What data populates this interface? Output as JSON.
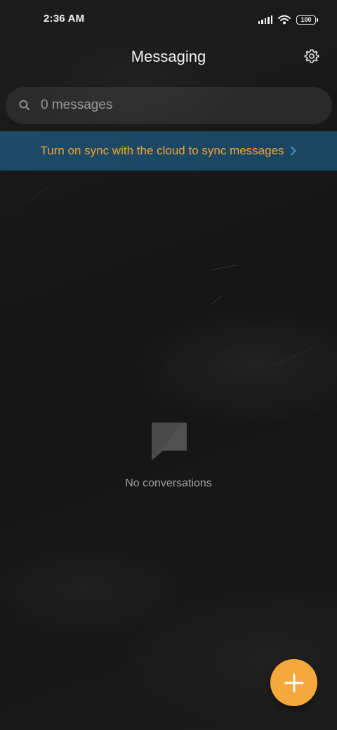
{
  "status_bar": {
    "time": "2:36 AM",
    "battery": "100",
    "icons": [
      "signal-icon",
      "wifi-icon",
      "battery-icon"
    ]
  },
  "header": {
    "title": "Messaging",
    "settings_icon": "gear-icon"
  },
  "search": {
    "placeholder": "0 messages",
    "icon": "search-icon"
  },
  "sync_banner": {
    "text": "Turn on sync with the cloud to sync messages",
    "icon": "chevron-right-icon",
    "text_color": "#f0a43a",
    "background": "#1c4862"
  },
  "empty_state": {
    "icon": "chat-bubble-icon",
    "label": "No conversations"
  },
  "fab": {
    "icon": "plus-icon",
    "color": "#f5a93a"
  }
}
